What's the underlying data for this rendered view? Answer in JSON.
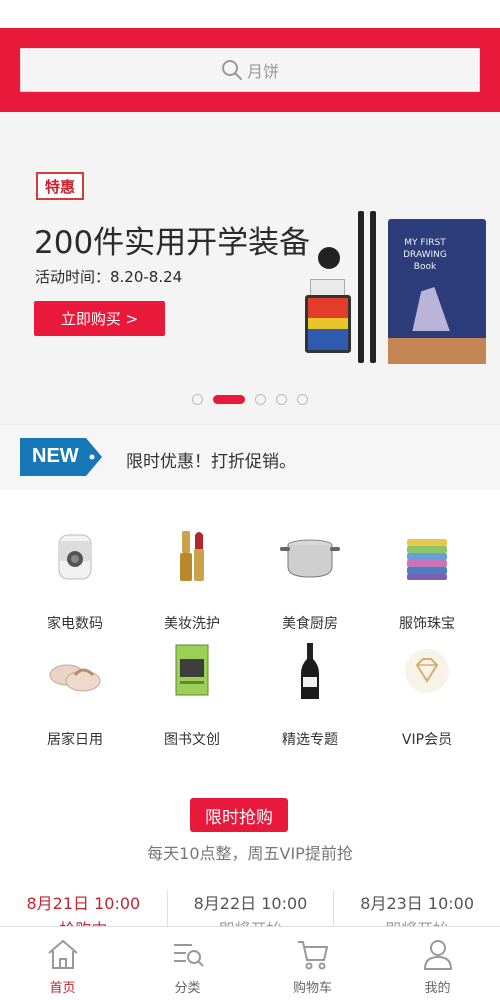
{
  "search": {
    "placeholder_text": "月饼",
    "icon": "search-icon"
  },
  "banner": {
    "badge": "特惠",
    "title": "200件实用开学装备",
    "date": "活动时间：8.20-8.24",
    "button": "立即购买 >",
    "book_title": "MY FIRST DRAWING Book",
    "slides": 5,
    "active_slide": 2
  },
  "notice": {
    "tag": "NEW",
    "text": "限时优惠！打折促销。"
  },
  "categories": [
    {
      "label": "家电数码",
      "icon": "appliance-icon"
    },
    {
      "label": "美妆洗护",
      "icon": "lipstick-icon"
    },
    {
      "label": "美食厨房",
      "icon": "pot-icon"
    },
    {
      "label": "服饰珠宝",
      "icon": "clothes-icon"
    },
    {
      "label": "居家日用",
      "icon": "slippers-icon"
    },
    {
      "label": "图书文创",
      "icon": "book-icon"
    },
    {
      "label": "精选专题",
      "icon": "wine-icon"
    },
    {
      "label": "VIP会员",
      "icon": "diamond-icon"
    }
  ],
  "flash_sale": {
    "title": "限时抢购",
    "subtitle": "每天10点整，周五VIP提前抢",
    "slots": [
      {
        "time": "8月21日 10:00",
        "status": "抢购中",
        "active": true
      },
      {
        "time": "8月22日 10:00",
        "status": "即将开始",
        "active": false
      },
      {
        "time": "8月23日 10:00",
        "status": "即将开始",
        "active": false
      }
    ]
  },
  "tabbar": [
    {
      "label": "首页",
      "icon": "home-icon",
      "active": true
    },
    {
      "label": "分类",
      "icon": "category-icon",
      "active": false
    },
    {
      "label": "购物车",
      "icon": "cart-icon",
      "active": false
    },
    {
      "label": "我的",
      "icon": "profile-icon",
      "active": false
    }
  ],
  "colors": {
    "brand": "#e8193a",
    "active_text": "#c8242f"
  }
}
